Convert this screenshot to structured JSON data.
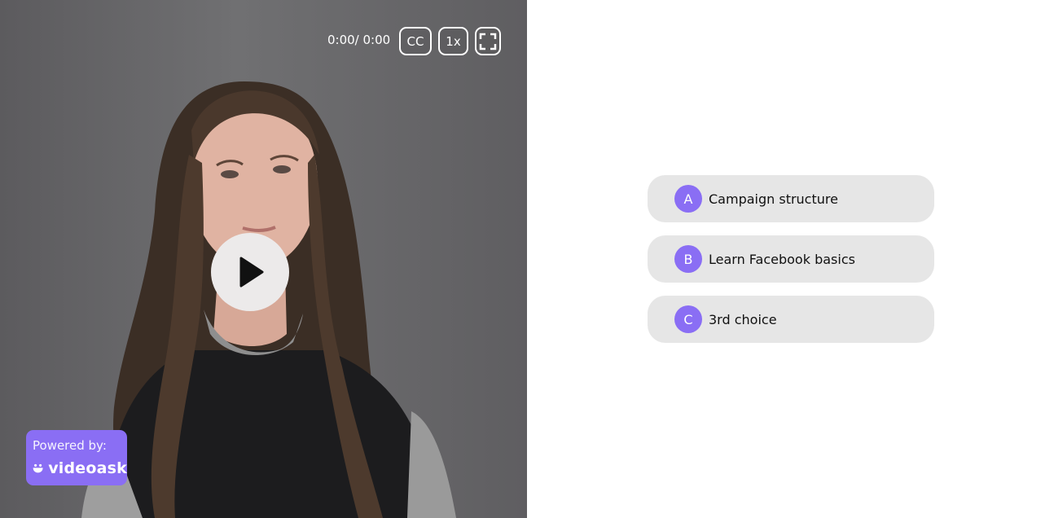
{
  "player": {
    "time": "0:00/ 0:00",
    "cc_label": "CC",
    "speed_label": "1x",
    "fullscreen_icon": "fullscreen-icon",
    "play_icon": "play-icon"
  },
  "branding": {
    "powered_by": "Powered by:",
    "brand_name": "videoask",
    "brand_icon": "smile-icon"
  },
  "choices": [
    {
      "letter": "A",
      "label": "Campaign structure"
    },
    {
      "letter": "B",
      "label": "Learn Facebook basics"
    },
    {
      "letter": "C",
      "label": "3rd choice"
    }
  ],
  "colors": {
    "accent": "#8a6ef4",
    "choice_bg": "#e6e6e6",
    "video_bg": "#6a696c"
  }
}
